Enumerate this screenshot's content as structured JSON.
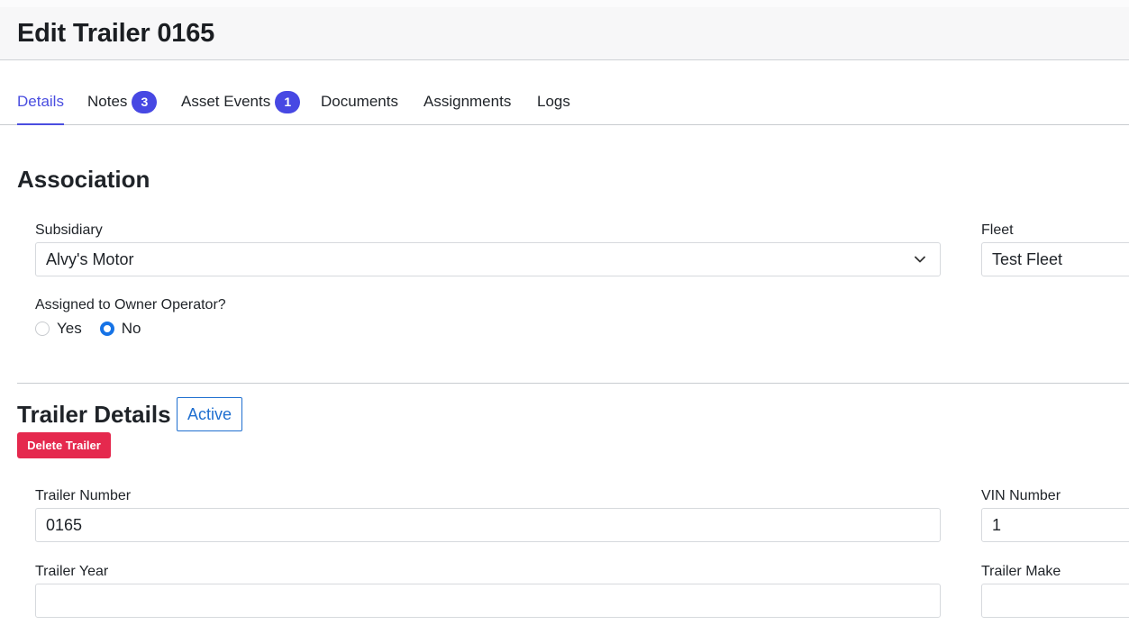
{
  "page": {
    "title": "Edit Trailer 0165"
  },
  "tabs": [
    {
      "label": "Details",
      "badge": ""
    },
    {
      "label": "Notes",
      "badge": "3"
    },
    {
      "label": "Asset Events",
      "badge": "1"
    },
    {
      "label": "Documents",
      "badge": ""
    },
    {
      "label": "Assignments",
      "badge": ""
    },
    {
      "label": "Logs",
      "badge": ""
    }
  ],
  "association": {
    "title": "Association",
    "subsidiary": {
      "label": "Subsidiary",
      "value": "Alvy's Motor"
    },
    "fleet": {
      "label": "Fleet",
      "value": "Test Fleet"
    },
    "owner_operator": {
      "label": "Assigned to Owner Operator?",
      "options": [
        "Yes",
        "No"
      ],
      "selected": "No"
    }
  },
  "trailer_details": {
    "title": "Trailer Details",
    "status": "Active",
    "delete_label": "Delete Trailer",
    "trailer_number": {
      "label": "Trailer Number",
      "value": "0165"
    },
    "vin_number": {
      "label": "VIN Number",
      "value": "1"
    },
    "trailer_year": {
      "label": "Trailer Year",
      "value": ""
    },
    "trailer_make": {
      "label": "Trailer Make",
      "value": ""
    }
  },
  "colors": {
    "accent": "#4a4ee0",
    "badge": "#4748e3",
    "danger": "#e5294e",
    "status": "#1f6fd0",
    "radio": "#1673e6"
  }
}
